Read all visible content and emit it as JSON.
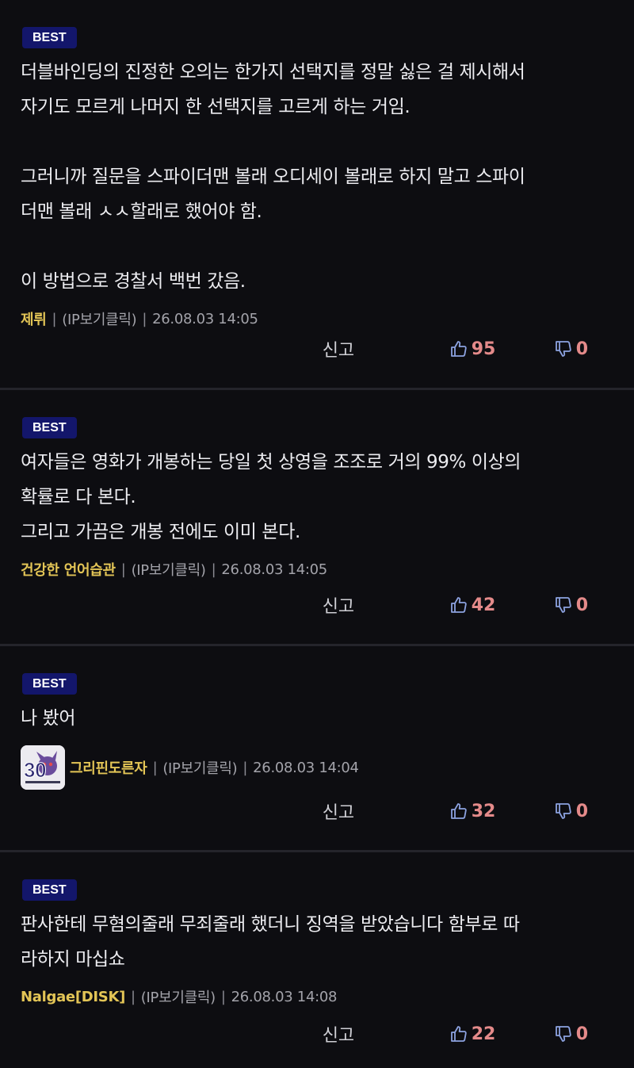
{
  "colors": {
    "background": "#0d0d11",
    "badge": "#13166b",
    "author": "#e3c556",
    "vote_count": "#e48a8a",
    "icon": "#8ca2e0"
  },
  "comments": [
    {
      "badge": "BEST",
      "text": "더블바인딩의 진정한 오의는 한가지 선택지를 정말 싫은 걸 제시해서\n자기도 모르게 나머지 한 선택지를 고르게 하는 거임.\n\n그러니까 질문을 스파이더맨 볼래 오디세이 볼래로 하지 말고 스파이\n더맨 볼래 ㅅㅅ할래로 했어야 함.\n\n이 방법으로 경찰서 백번 갔음.",
      "author": "제뤼",
      "ip": "(IP보기클릭)",
      "timestamp": "26.08.03 14:05",
      "report": "신고",
      "likes": "95",
      "dislikes": "0"
    },
    {
      "badge": "BEST",
      "text": "여자들은 영화가 개봉하는 당일 첫 상영을 조조로 거의 99% 이상의\n확률로 다 본다.\n그리고 가끔은 개봉 전에도 이미 본다.",
      "author": "건강한 언어습관",
      "ip": "(IP보기클릭)",
      "timestamp": "26.08.03 14:05",
      "report": "신고",
      "likes": "42",
      "dislikes": "0"
    },
    {
      "badge": "BEST",
      "text": "나 봤어",
      "author": "그리핀도른자",
      "ip": "(IP보기클릭)",
      "timestamp": "26.08.03 14:04",
      "report": "신고",
      "likes": "32",
      "dislikes": "0",
      "avatar_text": "30"
    },
    {
      "badge": "BEST",
      "text": "판사한테 무혐의줄래 무죄줄래 했더니 징역을 받았습니다 함부로 따\n라하지 마십쇼",
      "author": "Nalgae[DISK]",
      "ip": "(IP보기클릭)",
      "timestamp": "26.08.03 14:08",
      "report": "신고",
      "likes": "22",
      "dislikes": "0"
    }
  ],
  "icons": {
    "like": "thumbs-up-icon",
    "dislike": "thumbs-down-icon"
  }
}
